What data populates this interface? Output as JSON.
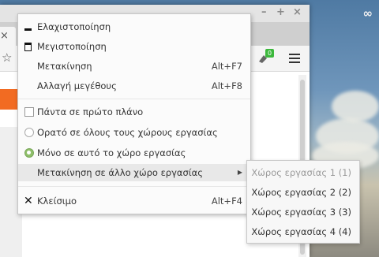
{
  "window_controls": {
    "minimize": "–",
    "maximize": "+",
    "close": "×"
  },
  "tab": {
    "close": "×"
  },
  "toolbar": {
    "extension_badge": "0"
  },
  "menu": {
    "items": [
      {
        "label": "Ελαχιστοποίηση",
        "accel": "",
        "icon": "minimize-icon"
      },
      {
        "label": "Μεγιστοποίηση",
        "accel": "",
        "icon": "maximize-icon"
      },
      {
        "label": "Μετακίνηση",
        "accel": "Alt+F7",
        "icon": ""
      },
      {
        "label": "Αλλαγή μεγέθους",
        "accel": "Alt+F8",
        "icon": ""
      },
      {
        "label": "Πάντα σε πρώτο πλάνο",
        "accel": "",
        "icon": "checkbox"
      },
      {
        "label": "Ορατό σε όλους τους χώρους εργασίας",
        "accel": "",
        "icon": "radio-unselected"
      },
      {
        "label": "Μόνο σε αυτό το χώρο εργασίας",
        "accel": "",
        "icon": "radio-selected"
      },
      {
        "label": "Μετακίνηση σε άλλο χώρο εργασίας",
        "accel": "",
        "icon": "submenu-arrow"
      },
      {
        "label": "Κλείσιμο",
        "accel": "Alt+F4",
        "icon": "close-icon"
      }
    ],
    "submenu_arrow": "▶",
    "close_glyph": "✕"
  },
  "submenu": {
    "items": [
      {
        "label": "Χώρος εργασίας 1 (1)",
        "disabled": true
      },
      {
        "label": "Χώρος εργασίας 2 (2)",
        "disabled": false
      },
      {
        "label": "Χώρος εργασίας 3 (3)",
        "disabled": false
      },
      {
        "label": "Χώρος εργασίας 4 (4)",
        "disabled": false
      }
    ]
  },
  "desktop": {
    "link_icon": "∞"
  }
}
